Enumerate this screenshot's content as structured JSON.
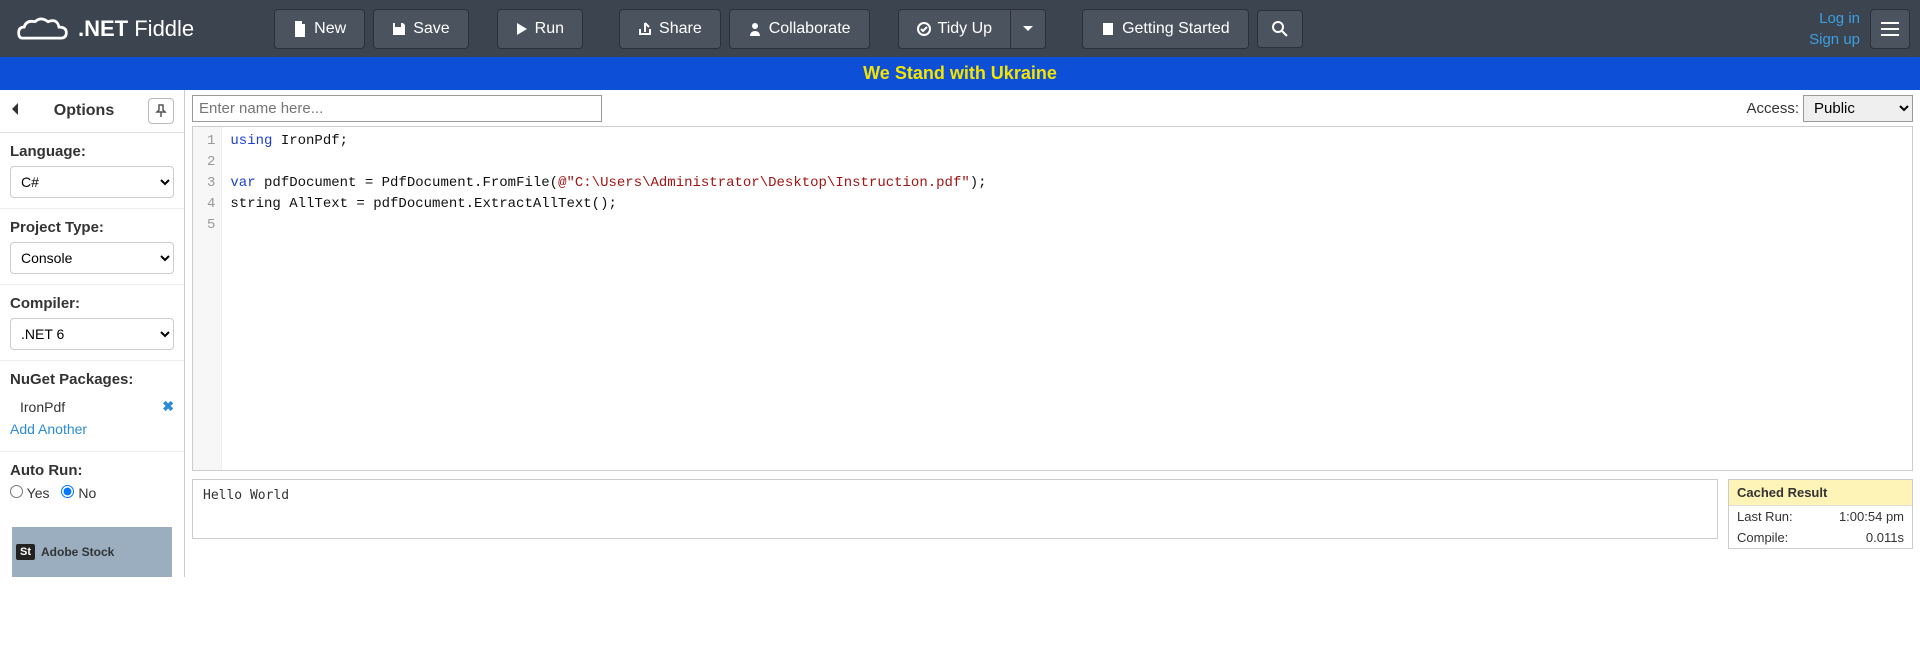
{
  "logo": {
    "brand_bold": ".NET",
    "brand_light": " Fiddle"
  },
  "toolbar": {
    "new": "New",
    "save": "Save",
    "run": "Run",
    "share": "Share",
    "collaborate": "Collaborate",
    "tidy": "Tidy Up",
    "getting_started": "Getting Started"
  },
  "auth": {
    "login": "Log in",
    "signup": "Sign up"
  },
  "banner": "We Stand with Ukraine",
  "sidebar": {
    "title": "Options",
    "language_label": "Language:",
    "language_value": "C#",
    "project_label": "Project Type:",
    "project_value": "Console",
    "compiler_label": "Compiler:",
    "compiler_value": ".NET 6",
    "nuget_label": "NuGet Packages:",
    "nuget_items": [
      "IronPdf"
    ],
    "add_another": "Add Another",
    "autorun_label": "Auto Run:",
    "autorun_yes": "Yes",
    "autorun_no": "No",
    "ad_badge": "St",
    "ad_text": "Adobe Stock"
  },
  "name_placeholder": "Enter name here...",
  "access": {
    "label": "Access:",
    "value": "Public"
  },
  "editor": {
    "lines": [
      "1",
      "2",
      "3",
      "4",
      "5"
    ]
  },
  "code": {
    "l1a": "using",
    "l1b": " IronPdf;",
    "l3a": "var",
    "l3b": " pdfDocument = PdfDocument.FromFile(",
    "l3c": "@\"C:\\Users\\Administrator\\Desktop\\Instruction.pdf\"",
    "l3d": ");",
    "l4": "string AllText = pdfDocument.ExtractAllText();"
  },
  "output": "Hello World",
  "stats": {
    "header": "Cached Result",
    "last_run_label": "Last Run:",
    "last_run_value": "1:00:54 pm",
    "compile_label": "Compile:",
    "compile_value": "0.011s"
  }
}
